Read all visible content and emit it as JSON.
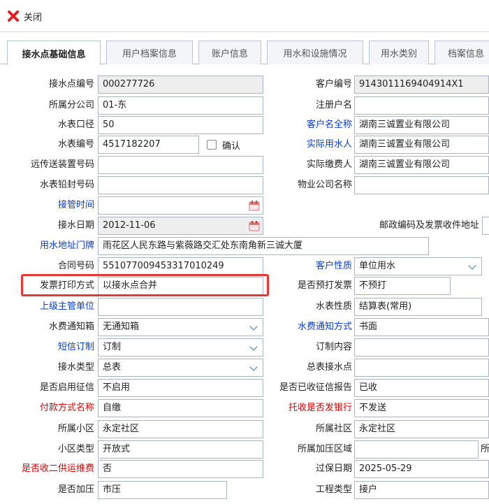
{
  "toolbar": {
    "close_label": "关闭"
  },
  "tabs": [
    {
      "label": "接水点基础信息"
    },
    {
      "label": "用户档案信息"
    },
    {
      "label": "账户信息"
    },
    {
      "label": "用水和设施情况"
    },
    {
      "label": "用水类别"
    },
    {
      "label": "档案信息"
    }
  ],
  "left": {
    "service_no": {
      "label": "接水点编号",
      "value": "000277726"
    },
    "branch": {
      "label": "所属分公司",
      "value": "01-东"
    },
    "meter_caliber": {
      "label": "水表口径",
      "value": "50"
    },
    "meter_no": {
      "label": "水表编号",
      "value": "4517182207"
    },
    "confirm": {
      "label": "确认"
    },
    "remote_device": {
      "label": "远传送装置号码",
      "value": ""
    },
    "meter_seal": {
      "label": "水表铅封号码",
      "value": ""
    },
    "takeover_time": {
      "label": "接管时间",
      "value": ""
    },
    "connect_date": {
      "label": "接水日期",
      "value": "2012-11-06"
    },
    "address": {
      "label": "用水地址门牌",
      "value": "雨花区人民东路与紫薇路交汇处东南角新三诚大厦"
    },
    "contract_no": {
      "label": "合同号码",
      "value": "551077009453317010249"
    },
    "invoice_print": {
      "label": "发票打印方式",
      "value": "以接水点合并"
    },
    "supervisor": {
      "label": "上级主管单位",
      "value": ""
    },
    "fee_notice_box": {
      "label": "水费通知箱",
      "value": "无通知箱"
    },
    "sms": {
      "label": "短信订制",
      "value": "订制"
    },
    "connect_type": {
      "label": "接水类型",
      "value": "总表"
    },
    "credit_enabled": {
      "label": "是否启用征信",
      "value": "不启用"
    },
    "payment_method": {
      "label": "付款方式名称",
      "value": "自缴"
    },
    "community": {
      "label": "所属小区",
      "value": "永定社区"
    },
    "community_type": {
      "label": "小区类型",
      "value": "开放式"
    },
    "secondary_fee": {
      "label": "是否收二供运维费",
      "value": "否"
    },
    "pressurized": {
      "label": "是否加压",
      "value": "市压"
    }
  },
  "right": {
    "customer_no": {
      "label": "客户编号",
      "value": "914301116940491​4X1"
    },
    "registered_name": {
      "label": "注册户名",
      "value": ""
    },
    "full_name": {
      "label": "客户名全称",
      "value": "湖南三诚置业有限公司"
    },
    "actual_user": {
      "label": "实际用水人",
      "value": "湖南三诚置业有限公司"
    },
    "actual_payer": {
      "label": "实际缴费人",
      "value": "湖南三诚置业有限公司"
    },
    "property_company": {
      "label": "物业公司名称",
      "value": ""
    },
    "postal_label": {
      "label": "邮政编码及发票收件地址"
    },
    "customer_nature": {
      "label": "客户性质",
      "value": "单位用水"
    },
    "pre_invoice": {
      "label": "是否预打发票",
      "value": "不预打"
    },
    "meter_nature": {
      "label": "水表性质",
      "value": "结算表(常用)"
    },
    "notice_method": {
      "label": "水费通知方式",
      "value": "书面"
    },
    "custom_content": {
      "label": "订制内容",
      "value": ""
    },
    "master_point": {
      "label": "总表接水点",
      "value": ""
    },
    "credit_report": {
      "label": "是否已收征信报告",
      "value": "已收"
    },
    "bank_collect": {
      "label": "托收是否发银行",
      "value": "不发送"
    },
    "district": {
      "label": "所属社区",
      "value": "永定社区"
    },
    "pressure_zone": {
      "label": "所属加压区域",
      "value": ""
    },
    "cutoff_char": {
      "value": "所"
    },
    "warranty_date": {
      "label": "过保日期",
      "value": "2025-05-29"
    },
    "project_type": {
      "label": "工程类型",
      "value": "接户"
    }
  }
}
